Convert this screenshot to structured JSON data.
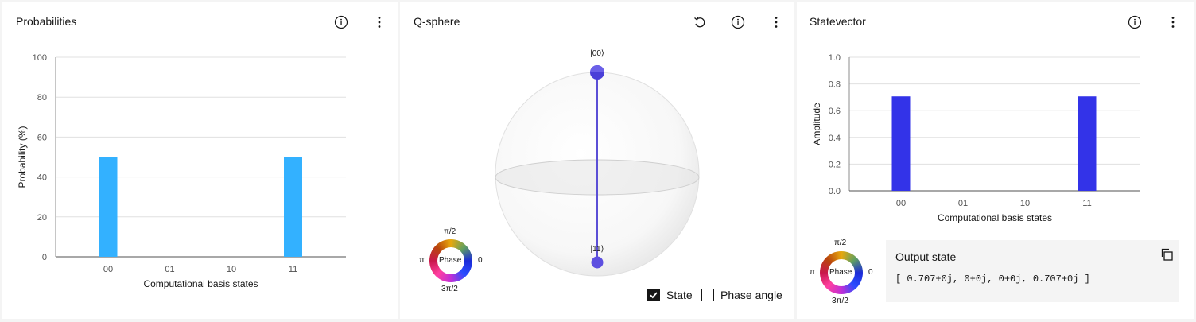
{
  "panels": {
    "probabilities": {
      "title": "Probabilities",
      "icons": [
        "info-icon",
        "overflow-menu-icon"
      ]
    },
    "qsphere": {
      "title": "Q-sphere",
      "icons": [
        "reset-icon",
        "info-icon",
        "overflow-menu-icon"
      ],
      "state_labels": [
        "|00⟩",
        "|11⟩"
      ],
      "phase_legend": {
        "center": "Phase",
        "top": "π/2",
        "left": "π",
        "right": "0",
        "bottom": "3π/2"
      },
      "checkboxes": [
        {
          "label": "State",
          "checked": true
        },
        {
          "label": "Phase angle",
          "checked": false
        }
      ]
    },
    "statevector": {
      "title": "Statevector",
      "icons": [
        "info-icon",
        "overflow-menu-icon"
      ],
      "phase_legend": {
        "center": "Phase",
        "top": "π/2",
        "left": "π",
        "right": "0",
        "bottom": "3π/2"
      },
      "output": {
        "title": "Output state",
        "value": "[ 0.707+0j, 0+0j, 0+0j, 0.707+0j ]"
      }
    }
  },
  "chart_data": [
    {
      "type": "bar",
      "categories": [
        "00",
        "01",
        "10",
        "11"
      ],
      "values": [
        50,
        0,
        0,
        50
      ],
      "xlabel": "Computational basis states",
      "ylabel": "Probability (%)",
      "ylim": [
        0,
        100
      ],
      "yticks": [
        "0",
        "20",
        "40",
        "60",
        "80",
        "100"
      ],
      "grid": true,
      "color": "#33b1ff"
    },
    {
      "type": "bar",
      "categories": [
        "00",
        "01",
        "10",
        "11"
      ],
      "values": [
        0.707,
        0,
        0,
        0.707
      ],
      "xlabel": "Computational basis states",
      "ylabel": "Amplitude",
      "ylim": [
        0,
        1
      ],
      "yticks": [
        "0.0",
        "0.2",
        "0.4",
        "0.6",
        "0.8",
        "1.0"
      ],
      "grid": true,
      "color": "#3333e8"
    }
  ]
}
